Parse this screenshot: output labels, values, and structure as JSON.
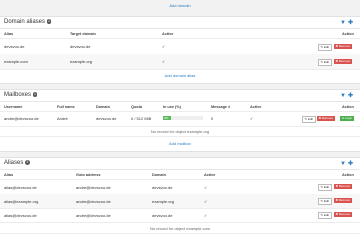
{
  "top": {
    "add_domain": "Add domain"
  },
  "domain_aliases": {
    "title": "Domain aliases",
    "count": "2",
    "headers": {
      "alias": "Alias",
      "target": "Target domain",
      "active": "Active",
      "action": "Action"
    },
    "rows": [
      {
        "alias": "devsvoo.de",
        "target": "devsvoo.de",
        "active": "✓"
      },
      {
        "alias": "example.com",
        "target": "example.org",
        "active": "✓"
      }
    ],
    "edit": "✎ Edit",
    "remove": "✖ Remove",
    "add_link": "Add domain alias"
  },
  "mailboxes": {
    "title": "Mailboxes",
    "count": "1",
    "headers": {
      "username": "Username",
      "fullname": "Full name",
      "domain": "Domain",
      "quota": "Quota",
      "inuse": "In use (%)",
      "messages": "Message #",
      "active": "Active",
      "action": "Action"
    },
    "rows": [
      {
        "username": "andre@devsvoo.de",
        "fullname": "André",
        "domain": "devsvoo.de",
        "quota": "0 / 512 MiB",
        "inuse": "0%",
        "inuse_fraction": 0.0,
        "messages": "0",
        "active": "✓"
      }
    ],
    "edit": "✎ Edit",
    "remove": "✖ Remove",
    "login": "➜ Login",
    "no_record": "No record for object example.org",
    "add_link": "Add mailbox"
  },
  "aliases": {
    "title": "Aliases",
    "count": "3",
    "headers": {
      "alias": "Alias",
      "goto": "Goto address",
      "domain": "Domain",
      "active": "Active",
      "action": "Action"
    },
    "rows": [
      {
        "alias": "alias@devsvoo.de",
        "goto": "andre@devsvoo.de",
        "domain": "devsvoo.de",
        "active": "✓"
      },
      {
        "alias": "alias@example.org",
        "goto": "andre@devsvoo.de",
        "domain": "example.org",
        "active": "✓"
      },
      {
        "alias": "alias@devsvoo.de",
        "goto": "andre@devsvoo.de",
        "domain": "devsvoo.de",
        "active": "✓"
      }
    ],
    "edit": "✎ Edit",
    "remove": "✖ Remove",
    "no_record": "No record for object example.com"
  },
  "icons": {
    "filter": "filter-icon",
    "add": "plus-icon"
  },
  "colors": {
    "link": "#2a7ec0",
    "remove": "#d9534f",
    "login": "#4cae4c",
    "progress": "#5cb85c"
  }
}
